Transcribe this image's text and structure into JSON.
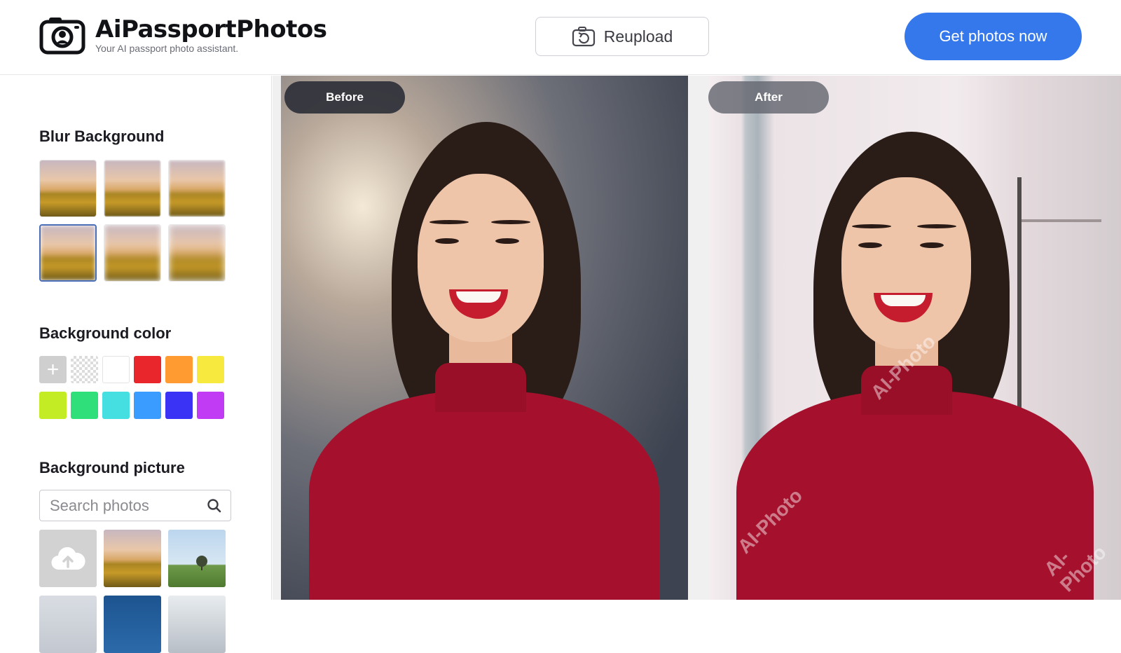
{
  "header": {
    "brand": "AiPassportPhotos",
    "tagline": "Your AI passport photo assistant.",
    "reupload_label": "Reupload",
    "cta_label": "Get photos now"
  },
  "sidebar": {
    "blur": {
      "title": "Blur Background",
      "selected_index": 3
    },
    "color": {
      "title": "Background color",
      "add_symbol": "+",
      "swatches": [
        "#e8262b",
        "#ff9b30",
        "#f7e93d",
        "#c4ec24",
        "#2fe07a",
        "#45dfe2",
        "#3a9cff",
        "#3a32f5",
        "#c13bf5"
      ]
    },
    "picture": {
      "title": "Background picture",
      "search_placeholder": "Search photos"
    }
  },
  "preview": {
    "before_label": "Before",
    "after_label": "After",
    "watermark": "AI-Photo"
  }
}
